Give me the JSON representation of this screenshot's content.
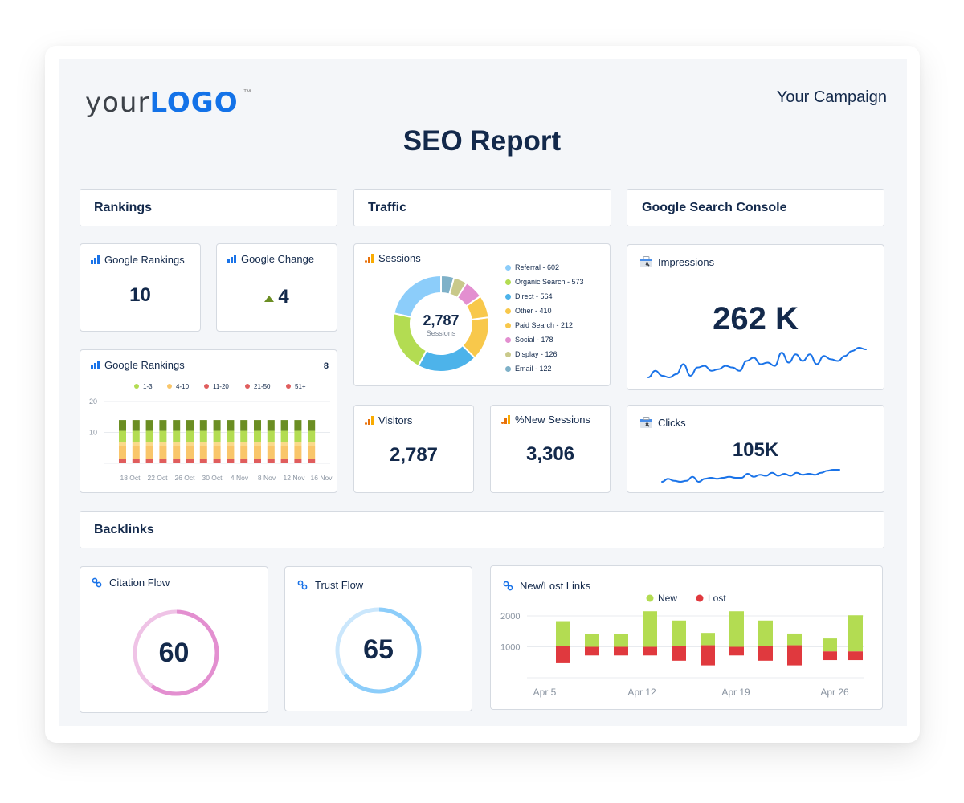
{
  "header": {
    "logo_prefix": "your",
    "logo_word": "LOGO",
    "logo_tm": "™",
    "campaign": "Your Campaign",
    "title": "SEO Report"
  },
  "sections": {
    "rankings": "Rankings",
    "traffic": "Traffic",
    "gsc": "Google Search Console",
    "backlinks": "Backlinks"
  },
  "rankings": {
    "google_rankings": {
      "label": "Google Rankings",
      "value": "10"
    },
    "google_change": {
      "label": "Google Change",
      "value": "4",
      "direction": "up"
    },
    "rankings_chart": {
      "label": "Google Rankings",
      "count": "8"
    }
  },
  "traffic": {
    "sessions": {
      "label": "Sessions",
      "total": "2,787",
      "total_label": "Sessions"
    },
    "visitors": {
      "label": "Visitors",
      "value": "2,787"
    },
    "new_sessions": {
      "label": "%New Sessions",
      "value": "3,306"
    }
  },
  "gsc": {
    "impressions": {
      "label": "Impressions",
      "value": "262 K"
    },
    "clicks": {
      "label": "Clicks",
      "value": "105K"
    }
  },
  "backlinks": {
    "citation_flow": {
      "label": "Citation Flow",
      "value": "60",
      "percent": 60,
      "color": "#e38fd0",
      "track": "#efc3e6"
    },
    "trust_flow": {
      "label": "Trust Flow",
      "value": "65",
      "percent": 65,
      "color": "#8ccdfa",
      "track": "#cbe7fc"
    },
    "new_lost": {
      "label": "New/Lost Links"
    }
  },
  "chart_data": [
    {
      "id": "sessions-donut",
      "type": "pie",
      "title": "Sessions",
      "center_value": "2,787",
      "center_label": "Sessions",
      "slices": [
        {
          "name": "Referral",
          "value": 602,
          "color": "#8ccdfa",
          "legend": "Referral - 602"
        },
        {
          "name": "Organic Search",
          "value": 573,
          "color": "#b3dc52",
          "legend": "Organic Search - 573"
        },
        {
          "name": "Direct",
          "value": 564,
          "color": "#4db3ea",
          "legend": "Direct - 564"
        },
        {
          "name": "Other",
          "value": 410,
          "color": "#f8c84b",
          "legend": "Other - 410"
        },
        {
          "name": "Paid Search",
          "value": 212,
          "color": "#f8c84b",
          "legend": "Paid Search - 212"
        },
        {
          "name": "Social",
          "value": 178,
          "color": "#e38fd0",
          "legend": "Social - 178"
        },
        {
          "name": "Display",
          "value": 126,
          "color": "#c9c98b",
          "legend": "Display - 126"
        },
        {
          "name": "Email",
          "value": 122,
          "color": "#7fb1c8",
          "legend": "Email - 122"
        }
      ]
    },
    {
      "id": "rankings-stacked",
      "type": "bar",
      "title": "Google Rankings",
      "stacked": true,
      "ylim": [
        0,
        20
      ],
      "yticks": [
        10,
        20
      ],
      "x_tick_labels": [
        "18 Oct",
        "22 Oct",
        "26 Oct",
        "30 Oct",
        "4 Nov",
        "8 Nov",
        "12 Nov",
        "16 Nov"
      ],
      "bar_count": 15,
      "series": [
        {
          "name": "51+",
          "color": "#e05d5d",
          "value": 1.5
        },
        {
          "name": "21-50",
          "color": "#f9c66a",
          "value": 4
        },
        {
          "name": "11-20",
          "color": "#fad98a",
          "value": 1.5
        },
        {
          "name": "4-10",
          "color": "#b3dc52",
          "value": 3.5
        },
        {
          "name": "1-3",
          "color": "#6b8e23",
          "value": 3.5
        }
      ],
      "legend": [
        {
          "name": "1-3",
          "color": "#b3dc52"
        },
        {
          "name": "4-10",
          "color": "#f9c66a"
        },
        {
          "name": "11-20",
          "color": "#e05d5d"
        },
        {
          "name": "21-50",
          "color": "#e05d5d"
        },
        {
          "name": "51+",
          "color": "#e05d5d"
        }
      ]
    },
    {
      "id": "new-lost-links",
      "type": "bar",
      "title": "New/Lost Links",
      "ylim": [
        0,
        2300
      ],
      "yticks": [
        1000,
        2000
      ],
      "x_tick_labels": [
        "Apr 5",
        "Apr 12",
        "Apr 19",
        "Apr 26"
      ],
      "legend": [
        {
          "name": "New",
          "color": "#b3dc52"
        },
        {
          "name": "Lost",
          "color": "#e0393e"
        }
      ],
      "series": [
        {
          "name": "New",
          "color": "#b3dc52",
          "values": [
            800,
            420,
            420,
            1150,
            820,
            400,
            1150,
            820,
            380,
            420,
            1170
          ]
        },
        {
          "name": "Lost",
          "color": "#e0393e",
          "values": [
            560,
            280,
            280,
            280,
            480,
            650,
            280,
            480,
            650,
            280,
            280
          ]
        }
      ],
      "baselines": [
        1030,
        1000,
        1000,
        1000,
        1030,
        1050,
        1000,
        1030,
        1050,
        850,
        850
      ]
    },
    {
      "id": "impressions-sparkline",
      "type": "line",
      "title": "Impressions",
      "values": [
        2,
        6,
        3,
        2,
        4,
        10,
        3,
        8,
        9,
        6,
        7,
        9,
        8,
        6,
        12,
        14,
        10,
        11,
        9,
        17,
        11,
        16,
        12,
        16,
        10,
        15,
        13,
        12,
        15,
        18,
        20,
        19
      ]
    },
    {
      "id": "clicks-sparkline",
      "type": "line",
      "title": "Clicks",
      "values": [
        2,
        5,
        3,
        2,
        3,
        7,
        2,
        5,
        6,
        5,
        6,
        7,
        6,
        6,
        10,
        7,
        9,
        8,
        11,
        8,
        10,
        8,
        11,
        9,
        10,
        9,
        11,
        13,
        14,
        14
      ]
    }
  ]
}
